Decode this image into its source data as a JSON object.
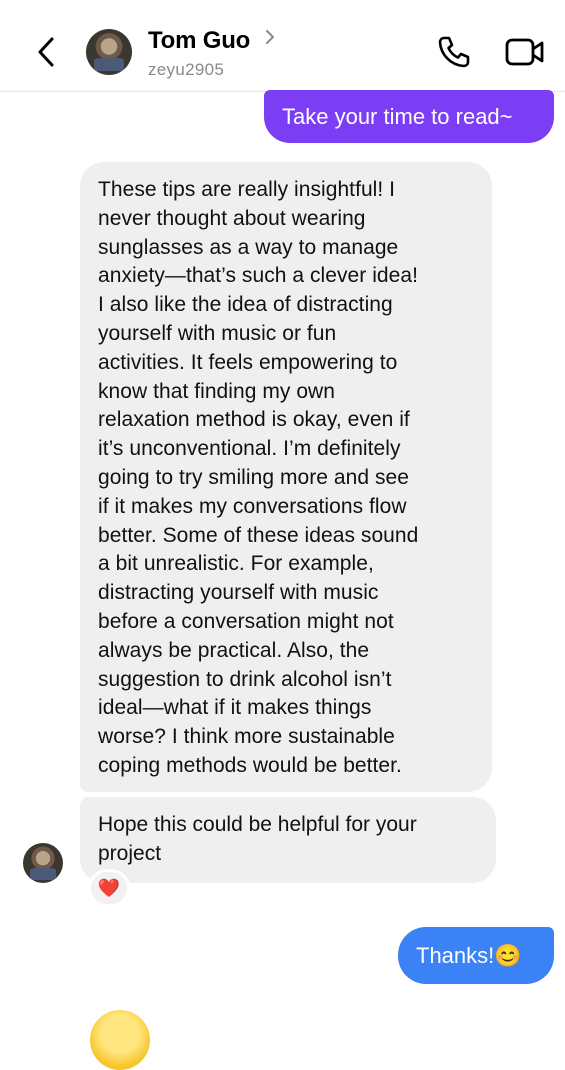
{
  "header": {
    "contact_name": "Tom Guo",
    "username": "zeyu2905",
    "icons": {
      "back": "chevron-left-icon",
      "profile_chevron": "chevron-right-icon",
      "phone": "phone-icon",
      "video": "video-camera-icon"
    }
  },
  "messages": [
    {
      "direction": "outgoing",
      "text": "Take your time to read~",
      "color": "#7b3ef5"
    },
    {
      "direction": "incoming",
      "lines": [
        "These tips are really insightful! I",
        "never thought about wearing",
        "sunglasses as a way to manage",
        "anxiety—that’s such a clever idea!",
        "I also like the idea of distracting",
        "yourself with music or fun",
        "activities. It feels empowering to",
        "know that finding my own",
        "relaxation method is okay, even if",
        "it’s unconventional. I’m definitely",
        "going to try smiling more and see",
        "if it makes my conversations flow",
        "better. Some of these ideas sound",
        "a bit unrealistic. For example,",
        "distracting yourself with music",
        "before a conversation might not",
        "always be practical. Also, the",
        "suggestion to drink alcohol isn’t",
        "ideal—what if it makes things",
        "worse? I think more sustainable",
        "coping methods would be better."
      ]
    },
    {
      "direction": "incoming",
      "lines": [
        "Hope this could be helpful for your",
        "project"
      ],
      "reaction": "❤️"
    },
    {
      "direction": "outgoing",
      "text": "Thanks!😊",
      "color": "#3a82f6"
    }
  ],
  "colors": {
    "incoming_bubble": "#efeff0",
    "username_gray": "#8a8a8e"
  }
}
